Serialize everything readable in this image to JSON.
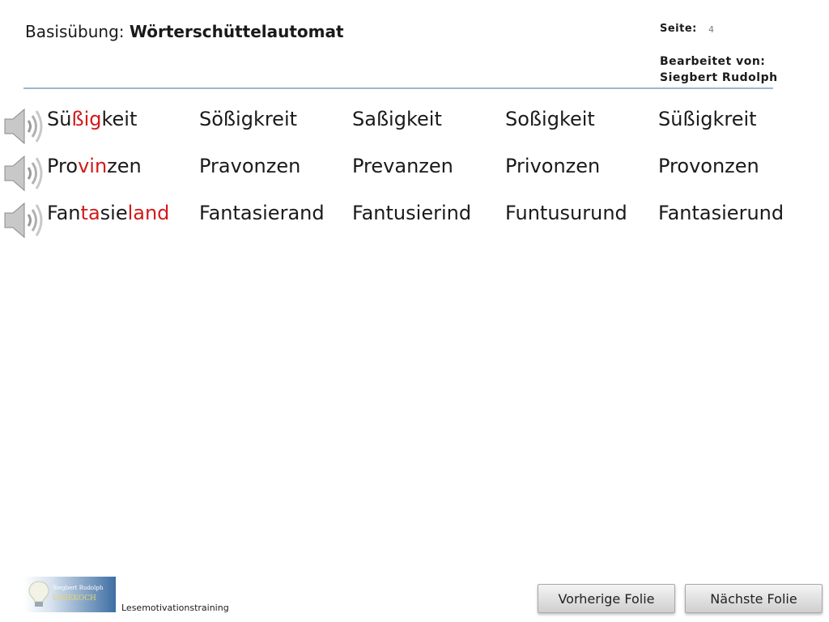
{
  "header": {
    "title_prefix": "Basisübung: ",
    "title_main": "Wörterschüttelautomat",
    "page_label": "Seite:",
    "page_number": "4",
    "editor_label": "Bearbeitet von:",
    "editor_name": "Siegbert Rudolph"
  },
  "rows": [
    {
      "target": [
        {
          "t": "Sü",
          "hl": false
        },
        {
          "t": "ßig",
          "hl": true
        },
        {
          "t": "keit",
          "hl": false
        }
      ],
      "options": [
        "Sößigkreit",
        "Saßigkeit",
        "Soßigkeit",
        "Süßigkreit"
      ]
    },
    {
      "target": [
        {
          "t": "Pro",
          "hl": false
        },
        {
          "t": "vin",
          "hl": true
        },
        {
          "t": "zen",
          "hl": false
        }
      ],
      "options": [
        "Pravonzen",
        "Prevanzen",
        "Privonzen",
        "Provonzen"
      ]
    },
    {
      "target": [
        {
          "t": "Fan",
          "hl": false
        },
        {
          "t": "ta",
          "hl": true
        },
        {
          "t": "sie",
          "hl": false
        },
        {
          "t": "land",
          "hl": true
        }
      ],
      "options": [
        "Fantasierand",
        "Fantusierind",
        "Funtusurund",
        "Fantasierund"
      ]
    }
  ],
  "footer": {
    "logo_line1": "Siegbert Rudolph",
    "logo_line2": "LESEKOCH",
    "caption": "Lesemotivationstraining",
    "prev_button": "Vorherige Folie",
    "next_button": "Nächste Folie"
  },
  "colors": {
    "highlight": "#d11a1a",
    "divider": "#a0b6c9"
  }
}
